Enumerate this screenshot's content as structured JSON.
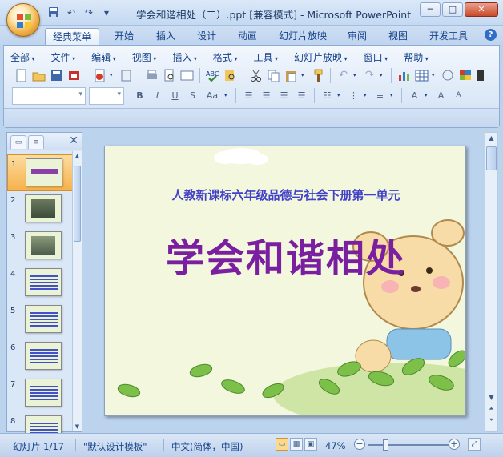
{
  "window": {
    "title": "学会和谐相处（二）.ppt [兼容模式] - Microsoft PowerPoint",
    "minimize": "─",
    "maximize": "□",
    "close": "✕"
  },
  "qat": [
    "save-icon",
    "undo-icon",
    "redo-icon",
    "customize-icon"
  ],
  "tabs": [
    "经典菜单",
    "开始",
    "插入",
    "设计",
    "动画",
    "幻灯片放映",
    "审阅",
    "视图",
    "开发工具"
  ],
  "active_tab": "经典菜单",
  "menu": [
    "全部",
    "文件",
    "编辑",
    "视图",
    "插入",
    "格式",
    "工具",
    "幻灯片放映",
    "窗口",
    "帮助"
  ],
  "format_buttons": [
    "B",
    "I",
    "U",
    "S",
    "Aa"
  ],
  "slide_panel": {
    "numbers": [
      "1",
      "2",
      "3",
      "4",
      "5",
      "6",
      "7",
      "8"
    ],
    "selected": 1
  },
  "slide": {
    "subtitle": "人教新课标六年级品德与社会下册第一单元",
    "title": "学会和谐相处"
  },
  "status": {
    "slide_info": "幻灯片 1/17",
    "theme": "\"默认设计模板\"",
    "language": "中文(简体，中国)",
    "zoom": "47%",
    "zoom_value": 0.47
  },
  "colors": {
    "accent_blue": "#15428b",
    "title_purple": "#7a1fa0",
    "subtitle_blue": "#4040c8",
    "selection": "#f6b24b"
  }
}
